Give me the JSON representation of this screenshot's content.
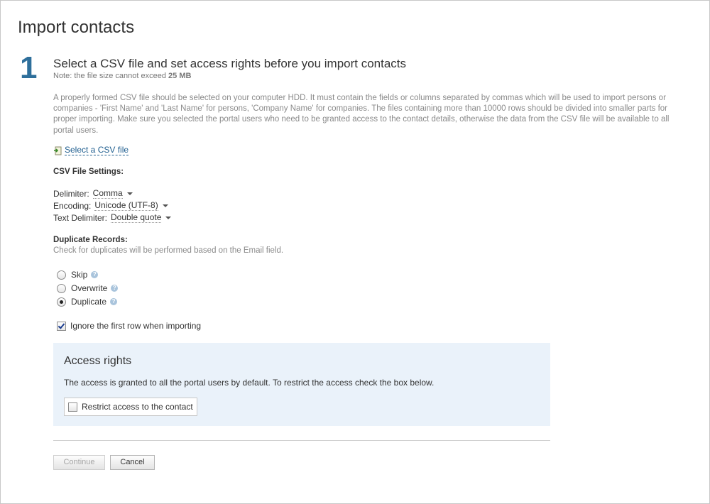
{
  "page": {
    "title": "Import contacts"
  },
  "step": {
    "number": "1",
    "title": "Select a CSV file and set access rights before you import contacts",
    "note_prefix": "Note: the file size cannot exceed",
    "note_size": "25 MB",
    "description": "A properly formed CSV file should be selected on your computer HDD. It must contain the fields or columns separated by commas which will be used to import persons or companies - 'First Name' and 'Last Name' for persons, 'Company Name' for companies. The files containing more than 10000 rows should be divided into smaller parts for proper importing. Make sure you selected the portal users who need to be granted access to the contact details, otherwise the data from the CSV file will be available to all portal users."
  },
  "select_file": {
    "label": "Select a CSV file",
    "icon": "file-import-icon"
  },
  "csv_settings": {
    "heading": "CSV File Settings:",
    "delimiter": {
      "label": "Delimiter:",
      "value": "Comma"
    },
    "encoding": {
      "label": "Encoding:",
      "value": "Unicode (UTF-8)"
    },
    "text_delimiter": {
      "label": "Text Delimiter:",
      "value": "Double quote"
    }
  },
  "duplicates": {
    "heading": "Duplicate Records:",
    "hint": "Check for duplicates will be performed based on the Email field.",
    "options": [
      {
        "label": "Skip",
        "selected": false
      },
      {
        "label": "Overwrite",
        "selected": false
      },
      {
        "label": "Duplicate",
        "selected": true
      }
    ],
    "help_icon": "?"
  },
  "ignore_first_row": {
    "label": "Ignore the first row when importing",
    "checked": true
  },
  "access_rights": {
    "title": "Access rights",
    "description": "The access is granted to all the portal users by default. To restrict the access check the box below.",
    "restrict_label": "Restrict access to the contact",
    "restrict_checked": false
  },
  "buttons": {
    "continue": "Continue",
    "cancel": "Cancel"
  },
  "colors": {
    "accent": "#2e6f9b",
    "link": "#1f5e8f",
    "panel": "#eaf2fa"
  }
}
